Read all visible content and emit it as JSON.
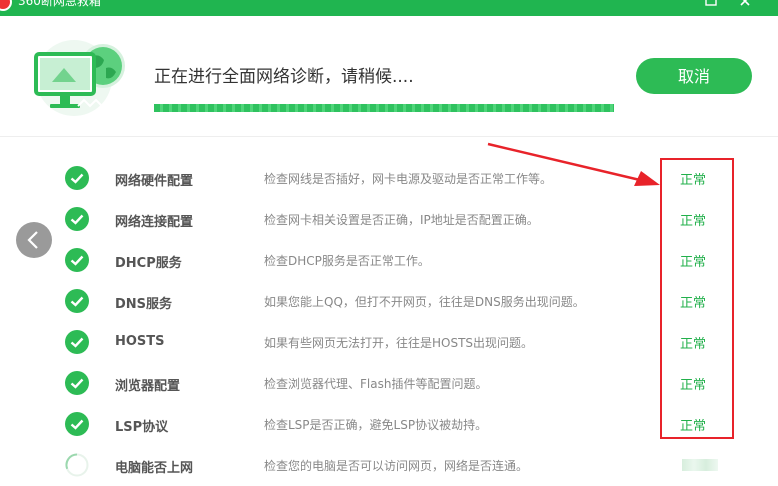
{
  "window": {
    "title": "360断网急救箱"
  },
  "header": {
    "status_text": "正在进行全面网络诊断，请稍候....",
    "progress": 1.0,
    "cancel_label": "取消"
  },
  "items": [
    {
      "name": "网络硬件配置",
      "desc": "检查网线是否插好，网卡电源及驱动是否正常工作等。",
      "status": "正常",
      "state": "done"
    },
    {
      "name": "网络连接配置",
      "desc": "检查网卡相关设置是否正确，IP地址是否配置正确。",
      "status": "正常",
      "state": "done"
    },
    {
      "name": "DHCP服务",
      "desc": "检查DHCP服务是否正常工作。",
      "status": "正常",
      "state": "done"
    },
    {
      "name": "DNS服务",
      "desc": "如果您能上QQ，但打不开网页，往往是DNS服务出现问题。",
      "status": "正常",
      "state": "done"
    },
    {
      "name": "HOSTS",
      "desc": "如果有些网页无法打开，往往是HOSTS出现问题。",
      "status": "正常",
      "state": "done"
    },
    {
      "name": "浏览器配置",
      "desc": "检查浏览器代理、Flash插件等配置问题。",
      "status": "正常",
      "state": "done"
    },
    {
      "name": "LSP协议",
      "desc": "检查LSP是否正确，避免LSP协议被劫持。",
      "status": "正常",
      "state": "done"
    },
    {
      "name": "电脑能否上网",
      "desc": "检查您的电脑是否可以访问网页，网络是否连通。",
      "status": "",
      "state": "checking"
    }
  ],
  "colors": {
    "brand_green": "#20b550",
    "status_green": "#22b04b",
    "annotation_red": "#e8232a"
  },
  "icons": {
    "done": "check-circle-icon",
    "checking": "loading-spinner-icon",
    "back": "chevron-left-icon"
  }
}
